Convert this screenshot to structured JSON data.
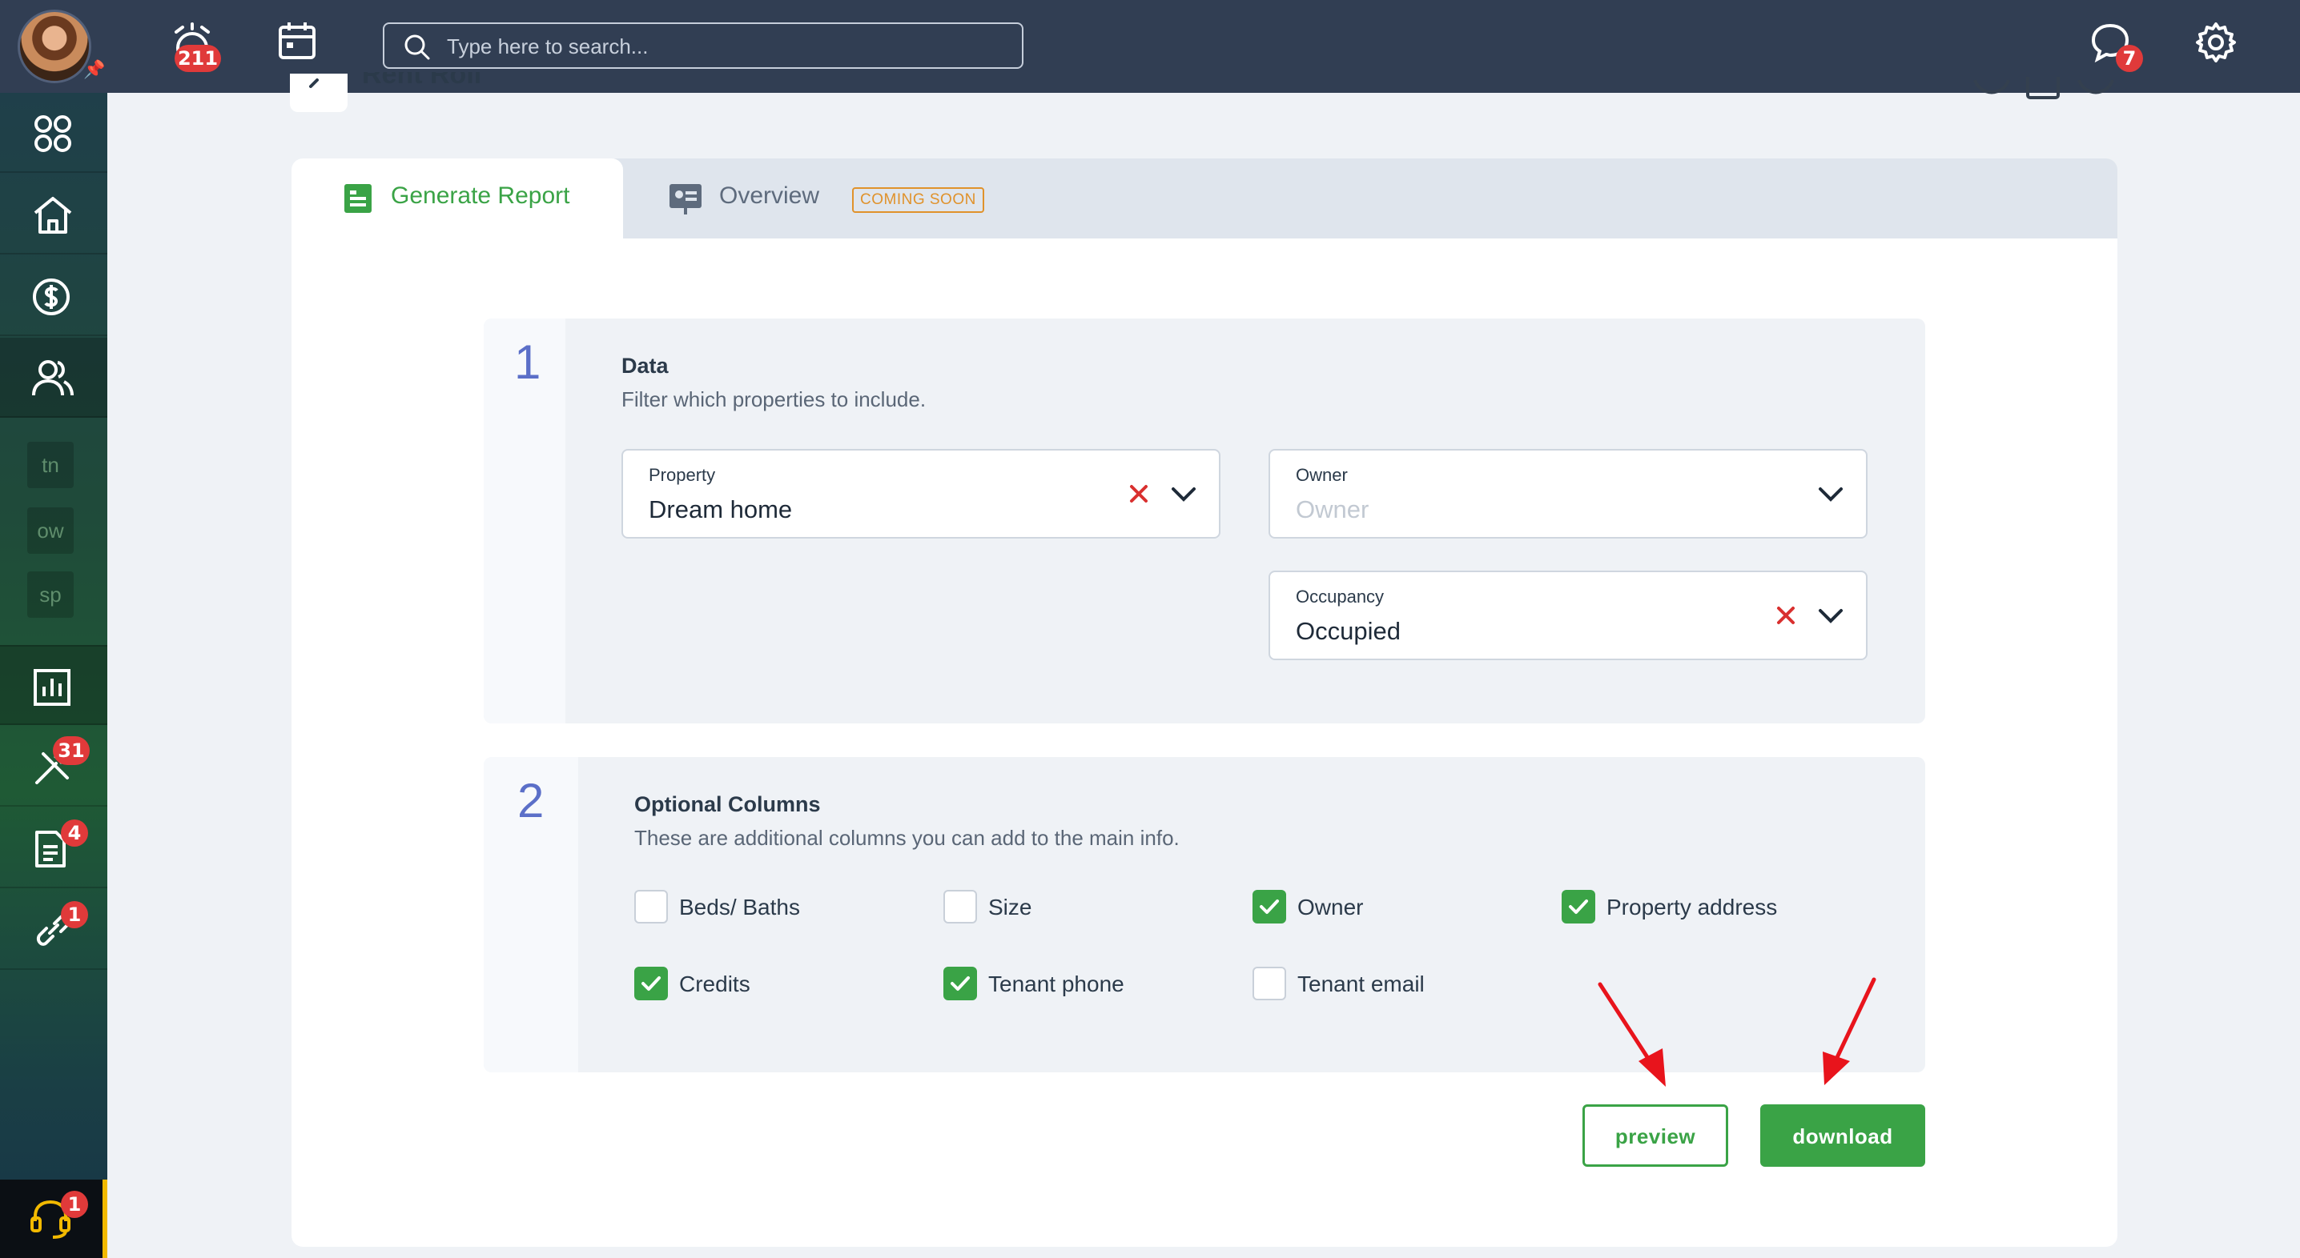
{
  "topbar": {
    "notifications_count": "211",
    "search_placeholder": "Type here to search...",
    "messages_count": "7"
  },
  "sidebar": {
    "chips": [
      "tn",
      "ow",
      "sp"
    ],
    "maintenance_count": "31",
    "documents_count": "4",
    "links_count": "1",
    "support_count": "1"
  },
  "page": {
    "title": "Rent Roll"
  },
  "tabs": {
    "generate_label": "Generate Report",
    "overview_label": "Overview",
    "coming_soon": "COMING SOON"
  },
  "section1": {
    "number": "1",
    "title": "Data",
    "description": "Filter which properties to include.",
    "property": {
      "label": "Property",
      "value": "Dream home"
    },
    "owner": {
      "label": "Owner",
      "placeholder": "Owner"
    },
    "occupancy": {
      "label": "Occupancy",
      "value": "Occupied"
    }
  },
  "section2": {
    "number": "2",
    "title": "Optional Columns",
    "description": "These are additional columns you can add to the main info.",
    "columns": [
      {
        "label": "Beds/ Baths",
        "checked": false
      },
      {
        "label": "Size",
        "checked": false
      },
      {
        "label": "Owner",
        "checked": true
      },
      {
        "label": "Property address",
        "checked": true
      },
      {
        "label": "Credits",
        "checked": true
      },
      {
        "label": "Tenant phone",
        "checked": true
      },
      {
        "label": "Tenant email",
        "checked": false
      }
    ]
  },
  "actions": {
    "preview_label": "preview",
    "download_label": "download"
  },
  "colors": {
    "accent_green": "#3aa346",
    "badge_red": "#e03a3a",
    "topbar": "#313e53",
    "arrow_red": "#e8141c"
  }
}
